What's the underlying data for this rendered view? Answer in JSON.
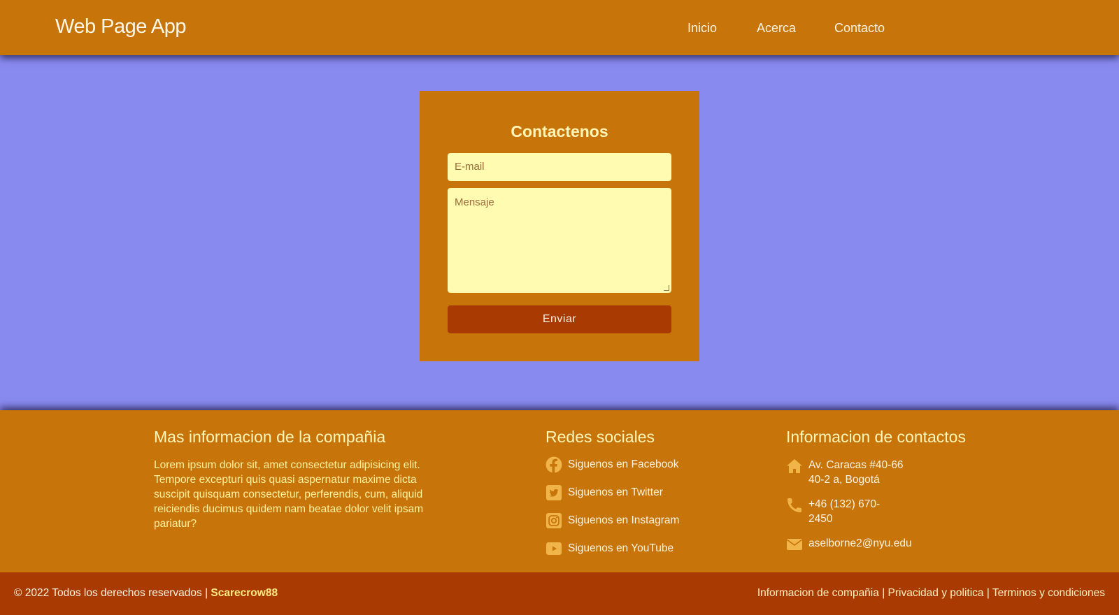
{
  "header": {
    "brand": "Web Page App",
    "nav": [
      "Inicio",
      "Acerca",
      "Contacto"
    ]
  },
  "contact_form": {
    "title": "Contactenos",
    "email_placeholder": "E-mail",
    "message_placeholder": "Mensaje",
    "submit_label": "Enviar"
  },
  "footer": {
    "about": {
      "title": "Mas informacion de la compañia",
      "text": "Lorem ipsum dolor sit, amet consectetur adipisicing elit. Tempore excepturi quis quasi aspernatur maxime dicta suscipit quisquam consectetur, perferendis, cum, aliquid reiciendis ducimus quidem nam beatae dolor velit ipsam pariatur?"
    },
    "social": {
      "title": "Redes sociales",
      "items": [
        {
          "label": "Siguenos en Facebook",
          "icon": "facebook-icon"
        },
        {
          "label": "Siguenos en Twitter",
          "icon": "twitter-icon"
        },
        {
          "label": "Siguenos en Instagram",
          "icon": "instagram-icon"
        },
        {
          "label": "Siguenos en YouTube",
          "icon": "youtube-icon"
        }
      ]
    },
    "contact": {
      "title": "Informacion de contactos",
      "address_line1": "Av. Caracas #40-66",
      "address_line2": "40-2 a, Bogotá",
      "phone_line1": "+46 (132) 670-",
      "phone_line2": "2450",
      "email": "aselborne2@nyu.edu"
    }
  },
  "bottom": {
    "copyright": "© 2022 Todos los derechos reservados |",
    "owner": "Scarecrow88",
    "links": [
      "Informacion de compañia",
      "Privacidad y politica",
      "Terminos y condiciones"
    ],
    "separator": "|"
  },
  "colors": {
    "background": "#898af0",
    "primary": "#c7740a",
    "dark_accent": "#a93a02",
    "input_bg": "#fffbb0",
    "heading": "#fff6b8"
  }
}
